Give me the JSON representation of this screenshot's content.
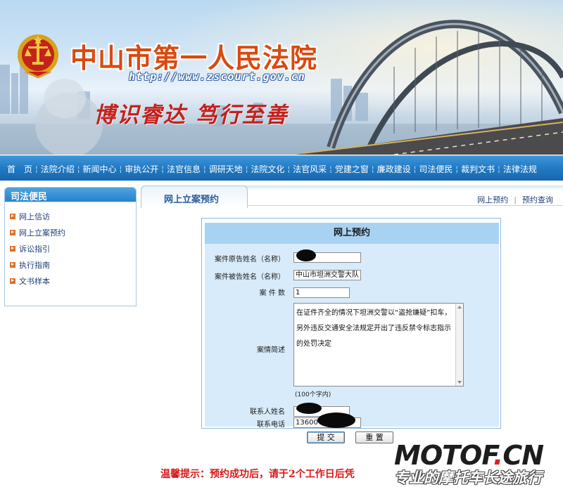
{
  "header": {
    "title": "中山市第一人民法院",
    "url": "http://www.zscourt.gov.cn",
    "motto": "博识睿达  笃行至善"
  },
  "nav": {
    "items": [
      "首　页",
      "法院介绍",
      "新闻中心",
      "审执公开",
      "法官信息",
      "调研天地",
      "法院文化",
      "法官风采",
      "党建之窗",
      "廉政建设",
      "司法便民",
      "裁判文书",
      "法律法规"
    ]
  },
  "sidebar": {
    "title": "司法便民",
    "items": [
      "网上信访",
      "网上立案预约",
      "诉讼指引",
      "执行指南",
      "文书样本"
    ]
  },
  "main": {
    "tab_title": "网上立案预约",
    "link_booking": "网上预约",
    "link_query": "预约查询"
  },
  "form": {
    "title": "网上预约",
    "plaintiff_label": "案件原告姓名（名称）",
    "plaintiff_value": "",
    "defendant_label": "案件被告姓名（名称）",
    "defendant_value": "中山市坦洲交警大队",
    "case_count_label": "案 件 数",
    "case_count_value": "1",
    "description_label": "案情简述",
    "description_value": "在证件齐全的情况下坦洲交警以“盗抢嫌疑”扣车，另外违反交通安全法规定开出了违反禁令标志指示的处罚决定",
    "description_hint": "(100个字内)",
    "contact_name_label": "联系人姓名",
    "contact_name_value": "",
    "contact_phone_label": "联系电话",
    "contact_phone_value": "13600",
    "submit_label": "提 交",
    "reset_label": "重 置"
  },
  "tip": "温馨提示：预约成功后，请于2个工作日后凭",
  "watermark": {
    "main": "MOTOF",
    "dot": ".",
    "tld": "CN",
    "sub": "专业的摩托车长途旅行"
  },
  "colors": {
    "nav": "#2077c2",
    "title_orange": "#d94a10",
    "motto_red": "#c4201c",
    "tip_red": "#d91818",
    "form_header": "#a8d2f2",
    "form_body": "#d8ebfa"
  }
}
